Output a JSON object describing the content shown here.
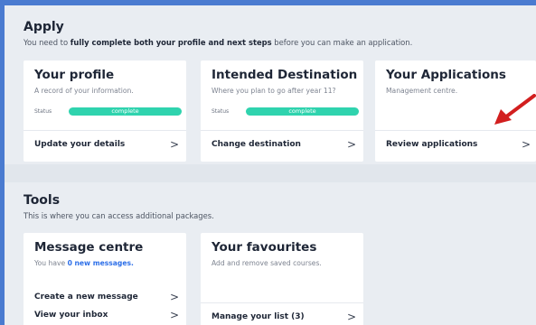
{
  "apply": {
    "title": "Apply",
    "subtitle_pre": "You need to ",
    "subtitle_bold": "fully complete both your profile and next steps",
    "subtitle_post": " before you can make an application.",
    "cards": [
      {
        "title": "Your profile",
        "desc": "A record of your information.",
        "status_label": "Status",
        "status_value": "complete",
        "link": "Update your details"
      },
      {
        "title": "Intended Destination",
        "desc": "Where you plan to go after year 11?",
        "status_label": "Status",
        "status_value": "complete",
        "link": "Change destination"
      },
      {
        "title": "Your Applications",
        "desc": "Management centre.",
        "link": "Review applications"
      }
    ]
  },
  "tools": {
    "title": "Tools",
    "subtitle": "This is where you can access additional packages.",
    "cards": [
      {
        "title": "Message centre",
        "desc_pre": "You have ",
        "desc_bold": "0 new messages.",
        "links": [
          "Create a new message",
          "View your inbox"
        ]
      },
      {
        "title": "Your favourites",
        "desc": "Add and remove saved courses.",
        "link": "Manage your list (3)"
      }
    ]
  },
  "chevron": ">",
  "colors": {
    "status_complete": "#2fd3ae",
    "annotation_arrow": "#d21f1f",
    "highlight_blue": "#2d6fe8",
    "border": "#4a7bd0"
  }
}
